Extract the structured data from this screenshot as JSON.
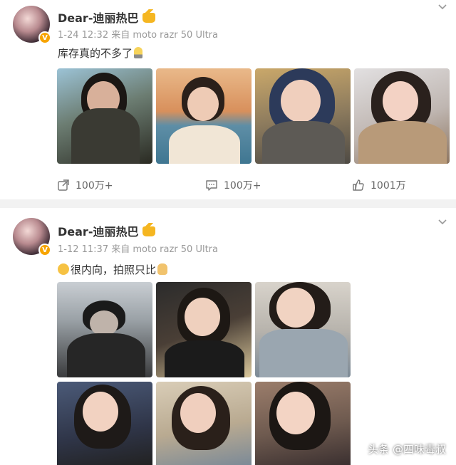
{
  "posts": [
    {
      "username": "Dear-迪丽热巴",
      "meta": "1-24 12:32 来自 moto razr 50 Ultra",
      "text": "库存真的不多了",
      "text_emoji": "bulb",
      "actions": {
        "repost_count": "100万+",
        "comment_count": "100万+",
        "like_count": "1001万"
      }
    },
    {
      "username": "Dear-迪丽热巴",
      "meta": "1-12 11:37 来自 moto razr 50 Ultra",
      "text": "很内向，拍照只比",
      "text_emoji_prefix": "surprised-face",
      "text_emoji_suffix": "victory-hand"
    }
  ],
  "watermark": "头条 @四味毒叔",
  "colors": {
    "verified_badge": "#f7a400",
    "meta_text": "#999999",
    "divider": "#f2f2f2"
  }
}
